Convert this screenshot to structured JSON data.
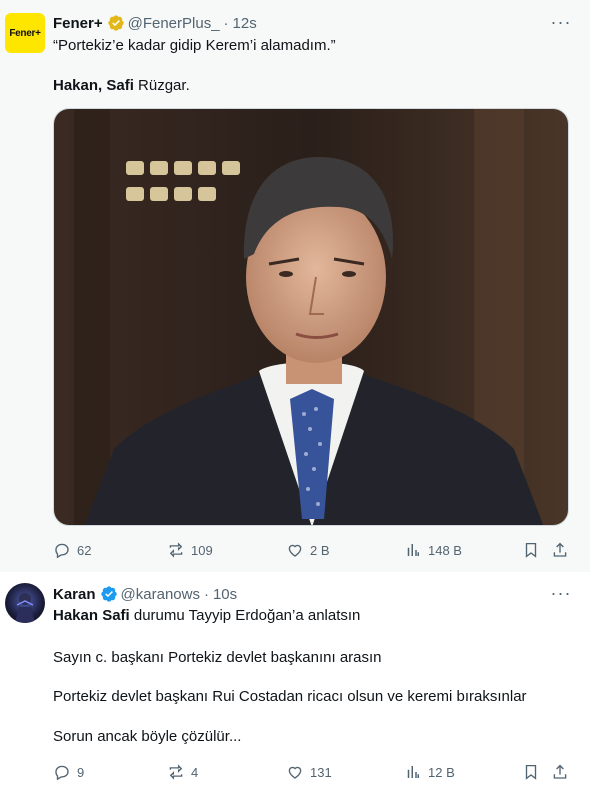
{
  "tweets": [
    {
      "name": "Fener+",
      "handle": "@FenerPlus_",
      "dot": "·",
      "time": "12s",
      "avatar_text": "Fener+",
      "lines": [
        "“Portekiz’e kadar gidip Kerem’i alamadım.”"
      ],
      "line2_bold": "Hakan, Safi",
      "line2_rest": " Rüzgar.",
      "media_icon": "photo-of-man-in-suit",
      "stats": {
        "replies": "62",
        "reposts": "109",
        "likes": "2 B",
        "views": "148 B"
      }
    },
    {
      "name": "Karan",
      "handle": "@karanows",
      "dot": "·",
      "time": "10s",
      "line1_bold": "Hakan Safi",
      "line1_rest": " durumu Tayyip Erdoğan’a anlatsın",
      "lines": [
        "Sayın c. başkanı Portekiz devlet başkanını arasın",
        "Portekiz devlet başkanı Rui Costadan ricacı olsun ve keremi bıraksınlar",
        "Sorun ancak böyle çözülür..."
      ],
      "stats": {
        "replies": "9",
        "reposts": "4",
        "likes": "131",
        "views": "12 B"
      }
    }
  ],
  "colors": {
    "verified_gold": "#e2b719",
    "verified_blue": "#1d9bf0",
    "muted": "#536471",
    "text": "#0f1419"
  },
  "icons": [
    "verified-badge-icon",
    "more-icon",
    "reply-icon",
    "repost-icon",
    "like-icon",
    "views-icon",
    "bookmark-icon",
    "share-icon"
  ]
}
